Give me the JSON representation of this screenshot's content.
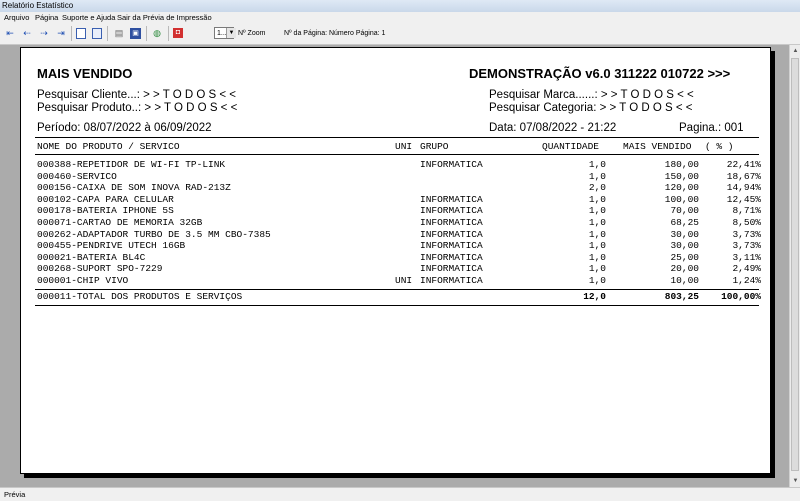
{
  "window": {
    "title": "Relatório Estatístico"
  },
  "menu": [
    "Arquivo",
    "Página",
    "Suporte e Ajuda",
    "Sair da Prévia de Impressão"
  ],
  "toolbar": {
    "icons": [
      "first-page-icon",
      "prev-page-icon",
      "next-page-icon",
      "last-page-icon",
      "single-page-icon",
      "two-pages-icon",
      "printer-icon",
      "save-icon",
      "globe-icon",
      "close-icon"
    ],
    "zoom_value": "1...",
    "zoom_label": "Nº Zoom",
    "page_label": "Nº da Página: Número Página: 1"
  },
  "report": {
    "title": "MAIS VENDIDO",
    "version": "DEMONSTRAÇÃO v6.0 311222 010722 >>>",
    "filter_cliente_label": "Pesquisar Cliente...:",
    "filter_cliente_value": "> > T O D O S < <",
    "filter_produto_label": "Pesquisar Produto..:",
    "filter_produto_value": "> > T O D O S < <",
    "filter_marca_label": "Pesquisar Marca......:",
    "filter_marca_value": "> > T O D O S < <",
    "filter_categoria_label": "Pesquisar Categoria:",
    "filter_categoria_value": "> > T O D O S < <",
    "periodo": "Período: 08/07/2022 à 06/09/2022",
    "data": "Data: 07/08/2022 - 21:22",
    "pagina": "Pagina.: 001",
    "columns": {
      "produto": "NOME DO PRODUTO / SERVICO",
      "uni": "UNI",
      "grupo": "GRUPO",
      "quantidade": "QUANTIDADE",
      "mais_vendido": "MAIS VENDIDO",
      "pct": "(   %   )"
    },
    "rows": [
      {
        "produto": "000388-REPETIDOR DE WI-FI TP-LINK",
        "uni": "",
        "grupo": "INFORMATICA",
        "qtd": "1,0",
        "valor": "180,00",
        "pct": "22,41%"
      },
      {
        "produto": "000460-SERVICO",
        "uni": "",
        "grupo": "",
        "qtd": "1,0",
        "valor": "150,00",
        "pct": "18,67%"
      },
      {
        "produto": "000156-CAIXA DE SOM INOVA RAD-213Z",
        "uni": "",
        "grupo": "",
        "qtd": "2,0",
        "valor": "120,00",
        "pct": "14,94%"
      },
      {
        "produto": "000102-CAPA PARA CELULAR",
        "uni": "",
        "grupo": "INFORMATICA",
        "qtd": "1,0",
        "valor": "100,00",
        "pct": "12,45%"
      },
      {
        "produto": "000178-BATERIA IPHONE 5S",
        "uni": "",
        "grupo": "INFORMATICA",
        "qtd": "1,0",
        "valor": "70,00",
        "pct": "8,71%"
      },
      {
        "produto": "000071-CARTAO DE MEMORIA 32GB",
        "uni": "",
        "grupo": "INFORMATICA",
        "qtd": "1,0",
        "valor": "68,25",
        "pct": "8,50%"
      },
      {
        "produto": "000262-ADAPTADOR TURBO DE 3.5 MM CBO-7385",
        "uni": "",
        "grupo": "INFORMATICA",
        "qtd": "1,0",
        "valor": "30,00",
        "pct": "3,73%"
      },
      {
        "produto": "000455-PENDRIVE UTECH 16GB",
        "uni": "",
        "grupo": "INFORMATICA",
        "qtd": "1,0",
        "valor": "30,00",
        "pct": "3,73%"
      },
      {
        "produto": "000021-BATERIA BL4C",
        "uni": "",
        "grupo": "INFORMATICA",
        "qtd": "1,0",
        "valor": "25,00",
        "pct": "3,11%"
      },
      {
        "produto": "000268-SUPORT SPO-7229",
        "uni": "",
        "grupo": "INFORMATICA",
        "qtd": "1,0",
        "valor": "20,00",
        "pct": "2,49%"
      },
      {
        "produto": "000001-CHIP VIVO",
        "uni": "UNI",
        "grupo": "INFORMATICA",
        "qtd": "1,0",
        "valor": "10,00",
        "pct": "1,24%"
      }
    ],
    "total": {
      "label": "000011-TOTAL DOS PRODUTOS E SERVIÇOS",
      "qtd": "12,0",
      "valor": "803,25",
      "pct": "100,00%"
    }
  },
  "status": "Prévia"
}
